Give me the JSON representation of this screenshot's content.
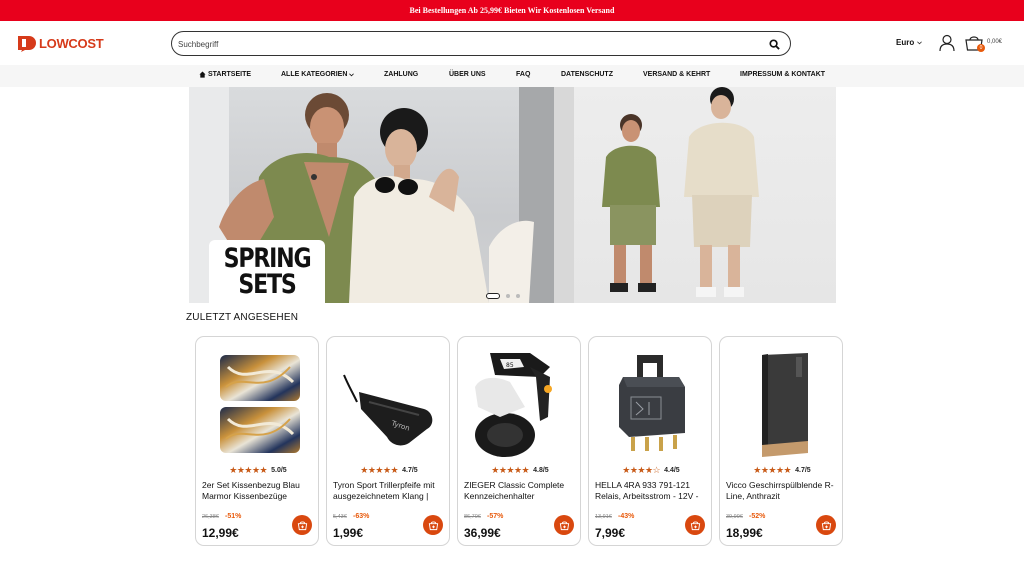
{
  "promo": {
    "text": "Bei Bestellungen Ab 25,99€ Bieten Wir Kostenlosen Versand"
  },
  "brand": {
    "name": "LOWCOST",
    "color": "#d63a1a"
  },
  "search": {
    "placeholder": "Suchbegriff",
    "icon": "search-icon"
  },
  "header": {
    "currency": "Euro",
    "cart_total": "0,00€",
    "cart_count": "0"
  },
  "nav": {
    "items": [
      {
        "label": "STARTSEITE",
        "icon": "home-icon"
      },
      {
        "label": "ALLE KATEGORIEN",
        "icon": "chevron-down-icon"
      },
      {
        "label": "ZAHLUNG"
      },
      {
        "label": "ÜBER UNS"
      },
      {
        "label": "FAQ"
      },
      {
        "label": "DATENSCHUTZ"
      },
      {
        "label": "VERSAND & KEHRT"
      },
      {
        "label": "IMPRESSUM & KONTAKT"
      }
    ]
  },
  "hero": {
    "headline_line1": "SPRING",
    "headline_line2": "SETS",
    "slides": 3,
    "active_slide": 1
  },
  "recently_viewed": {
    "title": "ZULETZT ANGESEHEN",
    "products": [
      {
        "title": "2er Set Kissenbezug Blau Marmor Kissenbezüge",
        "rating": "5.0/5",
        "stars": "★★★★★",
        "old_price": "26,38€",
        "discount": "-51%",
        "price": "12,99€",
        "image": "pillowcase"
      },
      {
        "title": "Tyron Sport Trillerpfeife mit ausgezeichnetem Klang |",
        "rating": "4.7/5",
        "stars": "★★★★★",
        "old_price": "5,43€",
        "discount": "-63%",
        "price": "1,99€",
        "image": "whistle"
      },
      {
        "title": "ZIEGER Classic Complete Kennzeichenhalter",
        "rating": "4.8/5",
        "stars": "★★★★★",
        "old_price": "86,70€",
        "discount": "-57%",
        "price": "36,99€",
        "image": "license-plate-holder"
      },
      {
        "title": "HELLA 4RA 933 791-121 Relais, Arbeitsstrom - 12V -",
        "rating": "4.4/5",
        "stars": "★★★★☆",
        "old_price": "13,91€",
        "discount": "-43%",
        "price": "7,99€",
        "image": "relay"
      },
      {
        "title": "Vicco Geschirrspülblende R-Line, Anthrazit",
        "rating": "4.7/5",
        "stars": "★★★★★",
        "old_price": "39,99€",
        "discount": "-52%",
        "price": "18,99€",
        "image": "dishwasher-panel"
      }
    ]
  },
  "colors": {
    "promo_red": "#e8001c",
    "accent_orange": "#d9480f",
    "discount_orange": "#e85a0c"
  }
}
